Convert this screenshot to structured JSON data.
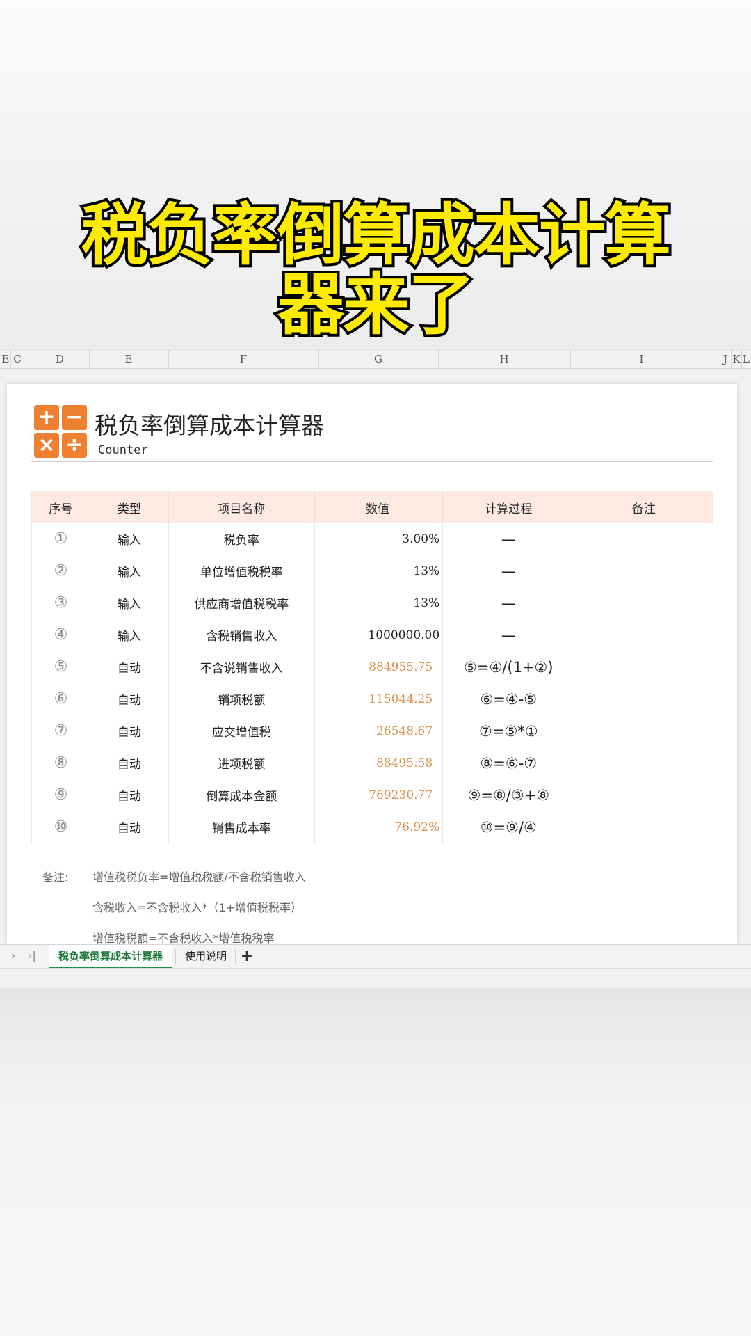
{
  "headline": {
    "line1": "税负率倒算成本计算",
    "line2": "器来了"
  },
  "column_headers": [
    "E",
    "C",
    "D",
    "E",
    "F",
    "G",
    "H",
    "I",
    "J",
    "K",
    "L"
  ],
  "sheet": {
    "title": "税负率倒算成本计算器",
    "subtitle": "Counter",
    "logo_symbols": [
      "+",
      "−",
      "×",
      "÷"
    ],
    "accent_color": "#ee8131",
    "table": {
      "headers": [
        "序号",
        "类型",
        "项目名称",
        "数值",
        "计算过程",
        "备注"
      ],
      "rows": [
        {
          "no": "①",
          "type": "输入",
          "name": "税负率",
          "value": "3.00%",
          "calc": "—",
          "note": ""
        },
        {
          "no": "②",
          "type": "输入",
          "name": "单位增值税税率",
          "value": "13%",
          "calc": "—",
          "note": ""
        },
        {
          "no": "③",
          "type": "输入",
          "name": "供应商增值税税率",
          "value": "13%",
          "calc": "—",
          "note": ""
        },
        {
          "no": "④",
          "type": "输入",
          "name": "含税销售收入",
          "value": "1000000.00",
          "calc": "—",
          "note": ""
        },
        {
          "no": "⑤",
          "type": "自动",
          "name": "不含说销售收入",
          "value": "884955.75",
          "calc": "⑤=④/(1+②)",
          "note": ""
        },
        {
          "no": "⑥",
          "type": "自动",
          "name": "销项税额",
          "value": "115044.25",
          "calc": "⑥=④-⑤",
          "note": ""
        },
        {
          "no": "⑦",
          "type": "自动",
          "name": "应交增值税",
          "value": "26548.67",
          "calc": "⑦=⑤*①",
          "note": ""
        },
        {
          "no": "⑧",
          "type": "自动",
          "name": "进项税额",
          "value": "88495.58",
          "calc": "⑧=⑥-⑦",
          "note": ""
        },
        {
          "no": "⑨",
          "type": "自动",
          "name": "倒算成本金额",
          "value": "769230.77",
          "calc": "⑨=⑧/③+⑧",
          "note": ""
        },
        {
          "no": "⑩",
          "type": "自动",
          "name": "销售成本率",
          "value": "76.92%",
          "calc": "⑩=⑨/④",
          "note": ""
        }
      ]
    },
    "notes": {
      "label": "备注:",
      "lines": [
        "增值税税负率=增值税税额/不含税销售收入",
        "含税收入=不含税收入*（1+增值税税率）",
        "增值税税额=不含税收入*增值税税率"
      ]
    }
  },
  "tabs": {
    "active": "税负率倒算成本计算器",
    "other": "使用说明",
    "add": "+",
    "nav_next": "›",
    "nav_last": "›|"
  }
}
